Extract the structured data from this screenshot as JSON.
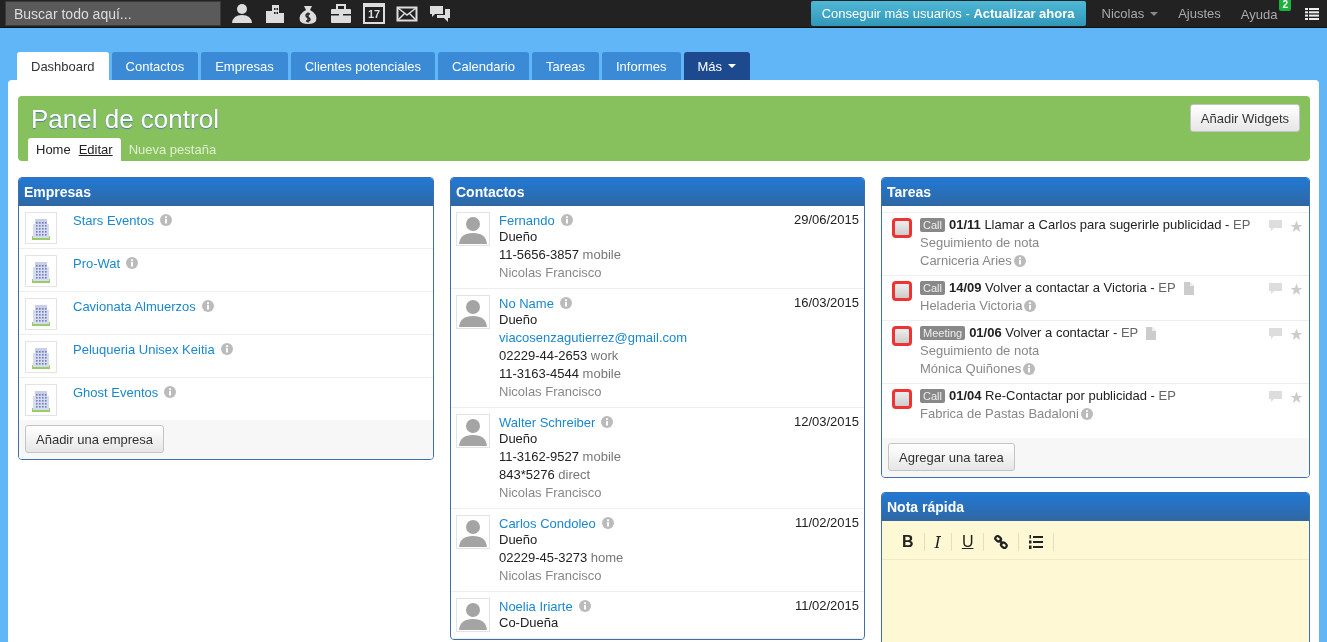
{
  "top_bar": {
    "search": {
      "placeholder": "Buscar todo aquí..."
    },
    "icons": [
      {
        "kind": "person"
      },
      {
        "kind": "buildings"
      },
      {
        "kind": "moneybag"
      },
      {
        "kind": "briefcase"
      },
      {
        "kind": "calendar",
        "text": "17"
      },
      {
        "kind": "envelope"
      },
      {
        "kind": "chat"
      }
    ],
    "promo": {
      "text": "Conseguir más usuarios - ",
      "strong": "Actualizar ahora"
    },
    "user": "Nicolas",
    "settings": "Ajustes",
    "help": "Ayuda",
    "help_badge": "2"
  },
  "tabs": [
    {
      "label": "Dashboard",
      "selected": true
    },
    {
      "label": "Contactos",
      "selected": false
    },
    {
      "label": "Empresas",
      "selected": false
    },
    {
      "label": "Clientes potenciales",
      "selected": false
    },
    {
      "label": "Calendario",
      "selected": false
    },
    {
      "label": "Tareas",
      "selected": false
    },
    {
      "label": "Informes",
      "selected": false
    },
    {
      "label": "Más",
      "selected": false,
      "kind": "dropdown"
    }
  ],
  "panel": {
    "title": "Panel de control",
    "add_button": "Añadir Widgets",
    "subtabs": [
      {
        "label": "Home",
        "selected": true,
        "edit": "Editar"
      },
      {
        "label": "Nueva pestaña",
        "selected": false
      }
    ]
  },
  "empresas": {
    "title": "Empresas",
    "items": [
      "Stars Eventos",
      "Pro-Wat",
      "Cavionata Almuerzos",
      "Peluqueria Unisex Keitia",
      "Ghost Eventos"
    ],
    "button": "Añadir una empresa"
  },
  "contactos": {
    "title": "Contactos",
    "items": [
      {
        "name": "Fernando",
        "date": "29/06/2015",
        "lines": [
          {
            "kind": "plain",
            "text": "Dueño"
          },
          {
            "kind": "phone",
            "text": "11-5656-3857",
            "type": "mobile"
          },
          {
            "kind": "owner",
            "text": "Nicolas Francisco"
          }
        ]
      },
      {
        "name": "No Name",
        "date": "16/03/2015",
        "lines": [
          {
            "kind": "plain",
            "text": "Dueño"
          },
          {
            "kind": "email",
            "text": "viacosenzagutierrez@gmail.com"
          },
          {
            "kind": "phone",
            "text": "02229-44-2653",
            "type": "work"
          },
          {
            "kind": "phone",
            "text": "11-3163-4544",
            "type": "mobile"
          },
          {
            "kind": "owner",
            "text": "Nicolas Francisco"
          }
        ]
      },
      {
        "name": "Walter Schreiber",
        "date": "12/03/2015",
        "lines": [
          {
            "kind": "plain",
            "text": "Dueño"
          },
          {
            "kind": "phone",
            "text": "11-3162-9527",
            "type": "mobile"
          },
          {
            "kind": "phone",
            "text": "843*5276",
            "type": "direct"
          },
          {
            "kind": "owner",
            "text": "Nicolas Francisco"
          }
        ]
      },
      {
        "name": "Carlos Condoleo",
        "date": "11/02/2015",
        "lines": [
          {
            "kind": "plain",
            "text": "Dueño"
          },
          {
            "kind": "phone",
            "text": "02229-45-3273",
            "type": "home"
          },
          {
            "kind": "owner",
            "text": "Nicolas Francisco"
          }
        ]
      },
      {
        "name": "Noelia Iriarte",
        "date": "11/02/2015",
        "lines": [
          {
            "kind": "plain",
            "text": "Co-Dueña"
          }
        ]
      }
    ]
  },
  "tareas": {
    "title": "Tareas",
    "button": "Agregar una tarea",
    "items": [
      {
        "checked": false,
        "tag": "Call",
        "date": "01/11",
        "title": "Llamar a Carlos para sugerirle publicidad -",
        "owner": "EP",
        "has_note": false,
        "note": "Seguimiento de nota",
        "company": "Carniceria Aries"
      },
      {
        "checked": false,
        "tag": "Call",
        "date": "14/09",
        "title": "Volver a contactar a Victoria -",
        "owner": "EP",
        "has_note": true,
        "company": "Heladeria Victoria"
      },
      {
        "checked": false,
        "tag": "Meeting",
        "date": "01/06",
        "title": "Volver a contactar -",
        "owner": "EP",
        "has_note": true,
        "note": "Seguimiento de nota",
        "company": "Mónica Quiñones"
      },
      {
        "checked": false,
        "tag": "Call",
        "date": "01/04",
        "title": "Re-Contactar por publicidad -",
        "owner": "EP",
        "has_note": false,
        "company": "Fabrica de Pastas Badaloni"
      }
    ]
  },
  "nota": {
    "title": "Nota rápida",
    "toolbar": [
      {
        "kind": "bold",
        "label": "B"
      },
      {
        "kind": "italic",
        "label": "I"
      },
      {
        "kind": "underline",
        "label": "U"
      },
      {
        "kind": "link"
      },
      {
        "kind": "list"
      }
    ]
  }
}
